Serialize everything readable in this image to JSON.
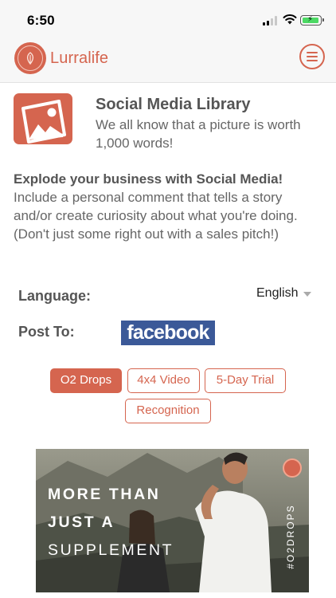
{
  "status_bar": {
    "time": "6:50"
  },
  "header": {
    "logo_text": "Lurralife"
  },
  "intro": {
    "title": "Social Media Library",
    "subtitle": "We all know that a picture is worth 1,000 words!"
  },
  "pitch": {
    "heading": "Explode your business with Social Media!",
    "body": "Include a personal comment that tells a story and/or create curiosity about what you're doing. (Don't just some right out with a sales pitch!)"
  },
  "options": {
    "language_label": "Language:",
    "language_value": "English",
    "post_to_label": "Post To:",
    "post_to_value": "facebook"
  },
  "categories": [
    {
      "label": "O2 Drops",
      "active": true
    },
    {
      "label": "4x4 Video",
      "active": false
    },
    {
      "label": "5-Day Trial",
      "active": false
    },
    {
      "label": "Recognition",
      "active": false
    }
  ],
  "preview": {
    "line1": "MORE THAN",
    "line2": "JUST A",
    "line3": "SUPPLEMENT",
    "hashtag": "#O2DROPS"
  },
  "colors": {
    "brand": "#d5654f",
    "facebook": "#3b5998",
    "battery": "#4cd964"
  },
  "icons": [
    "cellular-signal-icon",
    "wifi-icon",
    "battery-charging-icon",
    "lurralife-logo-icon",
    "hamburger-menu-icon",
    "image-gallery-icon",
    "dropdown-caret-icon"
  ]
}
